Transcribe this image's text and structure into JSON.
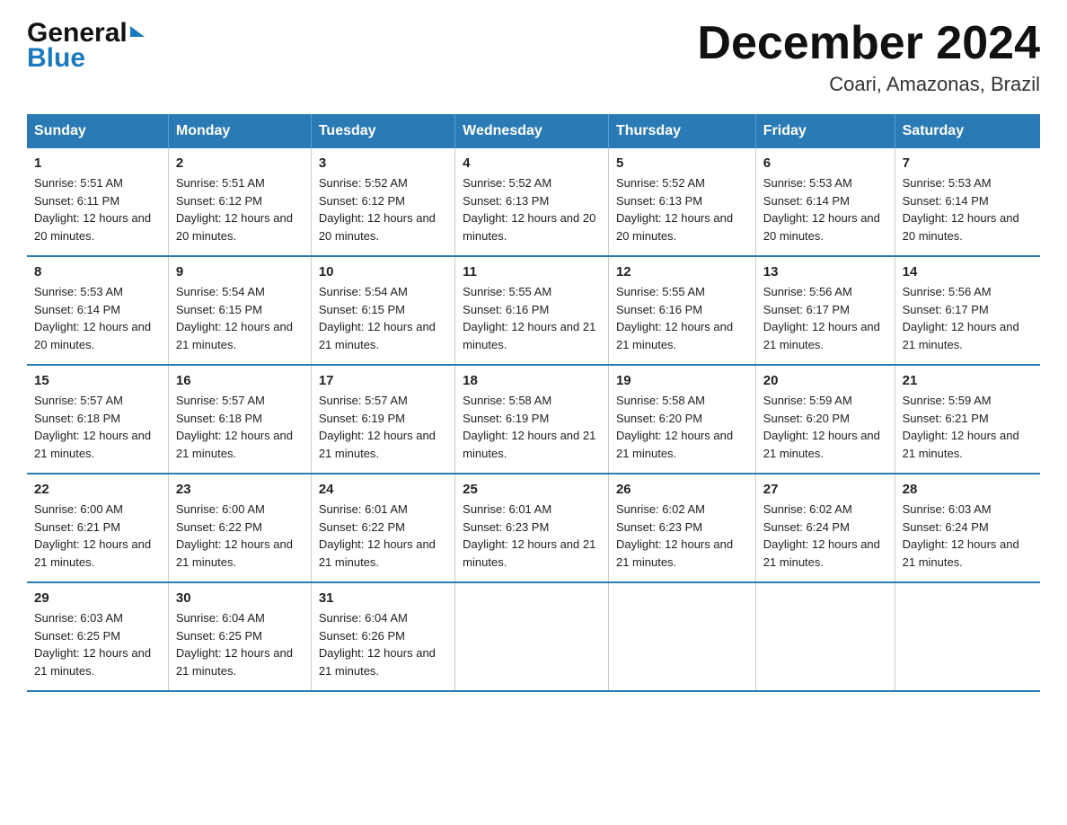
{
  "header": {
    "logo_line1": "General",
    "logo_line2": "Blue",
    "title": "December 2024",
    "subtitle": "Coari, Amazonas, Brazil"
  },
  "calendar": {
    "days_of_week": [
      "Sunday",
      "Monday",
      "Tuesday",
      "Wednesday",
      "Thursday",
      "Friday",
      "Saturday"
    ],
    "weeks": [
      [
        {
          "day": "1",
          "sunrise": "5:51 AM",
          "sunset": "6:11 PM",
          "daylight": "12 hours and 20 minutes."
        },
        {
          "day": "2",
          "sunrise": "5:51 AM",
          "sunset": "6:12 PM",
          "daylight": "12 hours and 20 minutes."
        },
        {
          "day": "3",
          "sunrise": "5:52 AM",
          "sunset": "6:12 PM",
          "daylight": "12 hours and 20 minutes."
        },
        {
          "day": "4",
          "sunrise": "5:52 AM",
          "sunset": "6:13 PM",
          "daylight": "12 hours and 20 minutes."
        },
        {
          "day": "5",
          "sunrise": "5:52 AM",
          "sunset": "6:13 PM",
          "daylight": "12 hours and 20 minutes."
        },
        {
          "day": "6",
          "sunrise": "5:53 AM",
          "sunset": "6:14 PM",
          "daylight": "12 hours and 20 minutes."
        },
        {
          "day": "7",
          "sunrise": "5:53 AM",
          "sunset": "6:14 PM",
          "daylight": "12 hours and 20 minutes."
        }
      ],
      [
        {
          "day": "8",
          "sunrise": "5:53 AM",
          "sunset": "6:14 PM",
          "daylight": "12 hours and 20 minutes."
        },
        {
          "day": "9",
          "sunrise": "5:54 AM",
          "sunset": "6:15 PM",
          "daylight": "12 hours and 21 minutes."
        },
        {
          "day": "10",
          "sunrise": "5:54 AM",
          "sunset": "6:15 PM",
          "daylight": "12 hours and 21 minutes."
        },
        {
          "day": "11",
          "sunrise": "5:55 AM",
          "sunset": "6:16 PM",
          "daylight": "12 hours and 21 minutes."
        },
        {
          "day": "12",
          "sunrise": "5:55 AM",
          "sunset": "6:16 PM",
          "daylight": "12 hours and 21 minutes."
        },
        {
          "day": "13",
          "sunrise": "5:56 AM",
          "sunset": "6:17 PM",
          "daylight": "12 hours and 21 minutes."
        },
        {
          "day": "14",
          "sunrise": "5:56 AM",
          "sunset": "6:17 PM",
          "daylight": "12 hours and 21 minutes."
        }
      ],
      [
        {
          "day": "15",
          "sunrise": "5:57 AM",
          "sunset": "6:18 PM",
          "daylight": "12 hours and 21 minutes."
        },
        {
          "day": "16",
          "sunrise": "5:57 AM",
          "sunset": "6:18 PM",
          "daylight": "12 hours and 21 minutes."
        },
        {
          "day": "17",
          "sunrise": "5:57 AM",
          "sunset": "6:19 PM",
          "daylight": "12 hours and 21 minutes."
        },
        {
          "day": "18",
          "sunrise": "5:58 AM",
          "sunset": "6:19 PM",
          "daylight": "12 hours and 21 minutes."
        },
        {
          "day": "19",
          "sunrise": "5:58 AM",
          "sunset": "6:20 PM",
          "daylight": "12 hours and 21 minutes."
        },
        {
          "day": "20",
          "sunrise": "5:59 AM",
          "sunset": "6:20 PM",
          "daylight": "12 hours and 21 minutes."
        },
        {
          "day": "21",
          "sunrise": "5:59 AM",
          "sunset": "6:21 PM",
          "daylight": "12 hours and 21 minutes."
        }
      ],
      [
        {
          "day": "22",
          "sunrise": "6:00 AM",
          "sunset": "6:21 PM",
          "daylight": "12 hours and 21 minutes."
        },
        {
          "day": "23",
          "sunrise": "6:00 AM",
          "sunset": "6:22 PM",
          "daylight": "12 hours and 21 minutes."
        },
        {
          "day": "24",
          "sunrise": "6:01 AM",
          "sunset": "6:22 PM",
          "daylight": "12 hours and 21 minutes."
        },
        {
          "day": "25",
          "sunrise": "6:01 AM",
          "sunset": "6:23 PM",
          "daylight": "12 hours and 21 minutes."
        },
        {
          "day": "26",
          "sunrise": "6:02 AM",
          "sunset": "6:23 PM",
          "daylight": "12 hours and 21 minutes."
        },
        {
          "day": "27",
          "sunrise": "6:02 AM",
          "sunset": "6:24 PM",
          "daylight": "12 hours and 21 minutes."
        },
        {
          "day": "28",
          "sunrise": "6:03 AM",
          "sunset": "6:24 PM",
          "daylight": "12 hours and 21 minutes."
        }
      ],
      [
        {
          "day": "29",
          "sunrise": "6:03 AM",
          "sunset": "6:25 PM",
          "daylight": "12 hours and 21 minutes."
        },
        {
          "day": "30",
          "sunrise": "6:04 AM",
          "sunset": "6:25 PM",
          "daylight": "12 hours and 21 minutes."
        },
        {
          "day": "31",
          "sunrise": "6:04 AM",
          "sunset": "6:26 PM",
          "daylight": "12 hours and 21 minutes."
        },
        null,
        null,
        null,
        null
      ]
    ]
  }
}
